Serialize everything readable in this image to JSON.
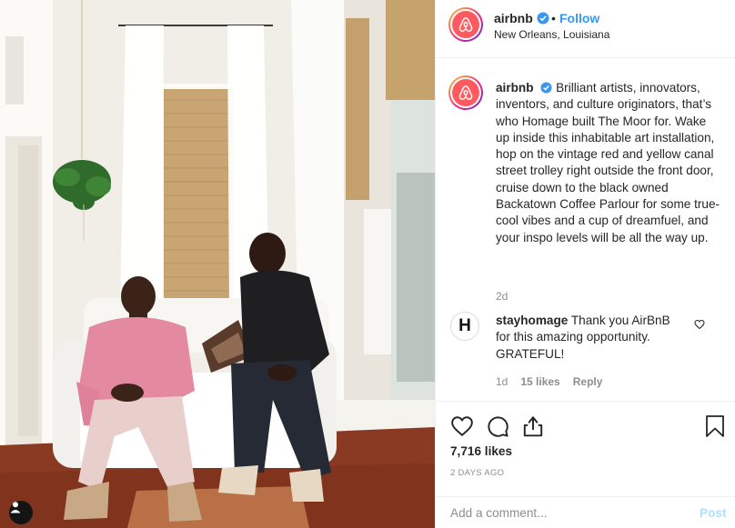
{
  "post": {
    "image_alt": "Two men sitting on a white sofa in a bright room",
    "tag_icon": "user-tag-icon"
  },
  "header": {
    "username": "airbnb",
    "verified": true,
    "separator": "•",
    "follow_label": "Follow",
    "location": "New Orleans, Louisiana"
  },
  "caption": {
    "username": "airbnb",
    "text": "Brilliant artists, innovators, inventors, and culture originators, that’s who Homage built The Moor for. Wake up inside this inhabitable art installation, hop on the vintage red and yellow canal street trolley right outside the front door, cruise down to the black owned Backatown Coffee Parlour for some true-cool vibes and a cup of dreamfuel, and your inspo levels will be all the way up.",
    "time": "2d"
  },
  "comments": [
    {
      "avatar_letter": "H",
      "username": "stayhomage",
      "text": "Thank you AirBnB for this amazing opportunity. GRATEFUL!",
      "time": "1d",
      "likes": "15 likes",
      "reply_label": "Reply"
    }
  ],
  "actions": {
    "icons": [
      "heart-icon",
      "comment-icon",
      "share-icon",
      "bookmark-icon"
    ],
    "likes": "7,716 likes",
    "posted_ago": "2 DAYS AGO"
  },
  "add_comment": {
    "placeholder": "Add a comment...",
    "post_label": "Post"
  },
  "colors": {
    "accent": "#3897f0",
    "brand": "#ff5a5f",
    "muted": "#8e8e8e",
    "post_disabled": "#b2dffc"
  }
}
